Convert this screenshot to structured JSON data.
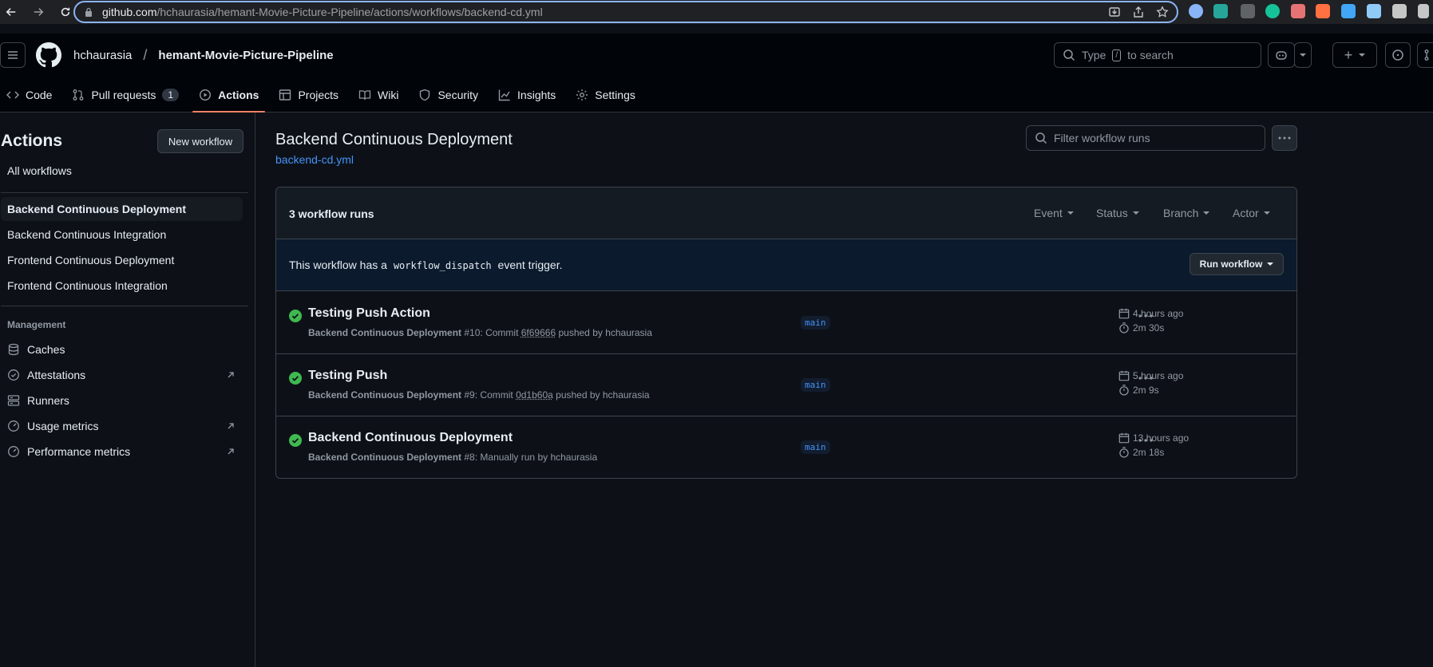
{
  "browser": {
    "url_host": "github.com",
    "url_path": "/hchaurasia/hemant-Movie-Picture-Pipeline/actions/workflows/backend-cd.yml"
  },
  "header": {
    "owner": "hchaurasia",
    "separator": "/",
    "repo": "hemant-Movie-Picture-Pipeline",
    "search_prefix": "Type",
    "search_key": "/",
    "search_suffix": "to search"
  },
  "tabs": [
    {
      "label": "Code",
      "icon": "code-icon"
    },
    {
      "label": "Pull requests",
      "icon": "pull-request-icon",
      "counter": "1"
    },
    {
      "label": "Actions",
      "icon": "play-icon",
      "active": true
    },
    {
      "label": "Projects",
      "icon": "table-icon"
    },
    {
      "label": "Wiki",
      "icon": "book-icon"
    },
    {
      "label": "Security",
      "icon": "shield-icon"
    },
    {
      "label": "Insights",
      "icon": "graph-icon"
    },
    {
      "label": "Settings",
      "icon": "gear-icon"
    }
  ],
  "sidebar": {
    "title": "Actions",
    "new_workflow": "New workflow",
    "all_workflows": "All workflows",
    "workflows": [
      "Backend Continuous Deployment",
      "Backend Continuous Integration",
      "Frontend Continuous Deployment",
      "Frontend Continuous Integration"
    ],
    "management_heading": "Management",
    "management": [
      {
        "label": "Caches",
        "icon": "database-icon"
      },
      {
        "label": "Attestations",
        "icon": "verified-icon",
        "external": true
      },
      {
        "label": "Runners",
        "icon": "server-icon"
      },
      {
        "label": "Usage metrics",
        "icon": "meter-icon",
        "external": true
      },
      {
        "label": "Performance metrics",
        "icon": "meter-icon",
        "external": true
      }
    ]
  },
  "main": {
    "title": "Backend Continuous Deployment",
    "file": "backend-cd.yml",
    "filter_placeholder": "Filter workflow runs",
    "runs_count": "3 workflow runs",
    "filters": [
      "Event",
      "Status",
      "Branch",
      "Actor"
    ],
    "dispatch_prefix": "This workflow has a",
    "dispatch_code": "workflow_dispatch",
    "dispatch_suffix": "event trigger.",
    "run_workflow": "Run workflow",
    "runs": [
      {
        "title": "Testing Push Action",
        "workflow": "Backend Continuous Deployment",
        "number": "#10",
        "desc_prefix": ": Commit",
        "commit": "6f69666",
        "desc_suffix": "pushed by hchaurasia",
        "branch": "main",
        "time": "4 hours ago",
        "duration": "2m 30s"
      },
      {
        "title": "Testing Push",
        "workflow": "Backend Continuous Deployment",
        "number": "#9",
        "desc_prefix": ": Commit",
        "commit": "0d1b60a",
        "desc_suffix": "pushed by hchaurasia",
        "branch": "main",
        "time": "5 hours ago",
        "duration": "2m 9s"
      },
      {
        "title": "Backend Continuous Deployment",
        "workflow": "Backend Continuous Deployment",
        "number": "#8",
        "desc_prefix": ": Manually run by hchaurasia",
        "commit": "",
        "desc_suffix": "",
        "branch": "main",
        "time": "13 hours ago",
        "duration": "2m 18s"
      }
    ]
  },
  "colors": {
    "background": "#0d1117",
    "header": "#010409",
    "success": "#3fb950",
    "link": "#4493f8",
    "tab_underline": "#f78166"
  }
}
